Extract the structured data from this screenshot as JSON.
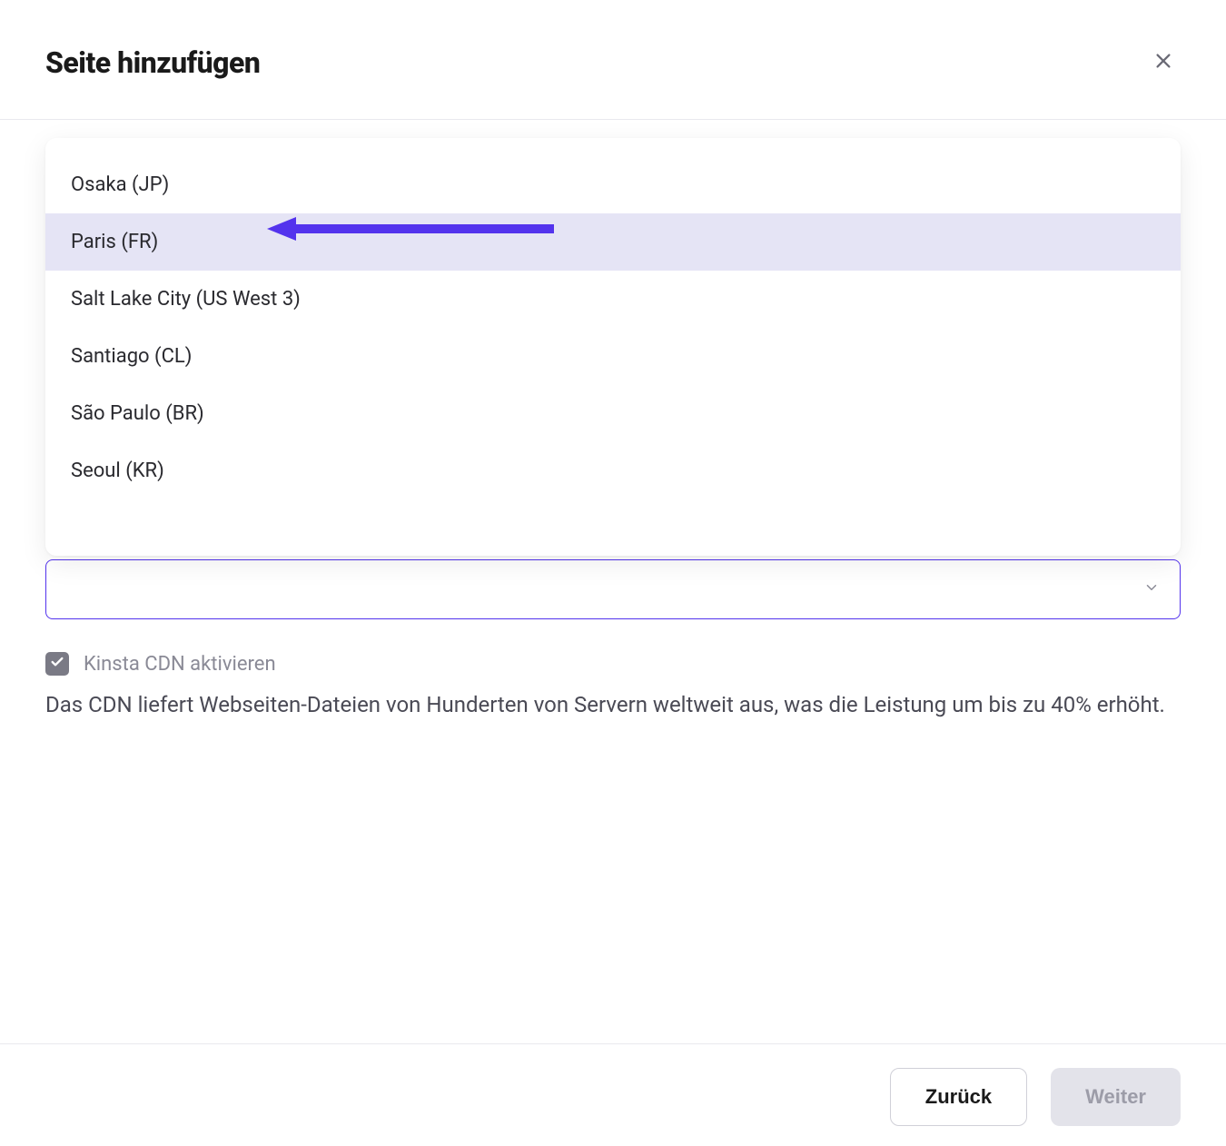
{
  "header": {
    "title": "Seite hinzufügen"
  },
  "dropdown": {
    "options": [
      {
        "label": "Osaka (JP)",
        "highlighted": false
      },
      {
        "label": "Paris (FR)",
        "highlighted": true
      },
      {
        "label": "Salt Lake City (US West 3)",
        "highlighted": false
      },
      {
        "label": "Santiago (CL)",
        "highlighted": false
      },
      {
        "label": "São Paulo (BR)",
        "highlighted": false
      },
      {
        "label": "Seoul (KR)",
        "highlighted": false
      }
    ]
  },
  "select": {
    "value": ""
  },
  "cdn": {
    "checkbox_label": "Kinsta CDN aktivieren",
    "checked": true,
    "description": "Das CDN liefert Webseiten-Dateien von Hunderten von Servern weltweit aus, was die Leistung um bis zu 40% erhöht."
  },
  "footer": {
    "back_label": "Zurück",
    "next_label": "Weiter"
  },
  "colors": {
    "accent": "#5333ed",
    "highlight_bg": "#e5e4f5"
  }
}
